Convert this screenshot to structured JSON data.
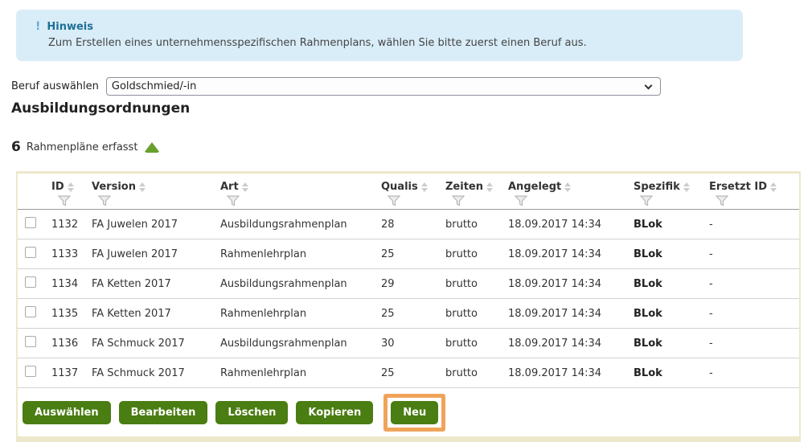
{
  "notice": {
    "icon": "!",
    "title": "Hinweis",
    "text": "Zum Erstellen eines unternehmensspezifischen Rahmenplans, wählen Sie bitte zuerst einen Beruf aus."
  },
  "beruf": {
    "label": "Beruf auswählen",
    "selected": "Goldschmied/-in"
  },
  "page": {
    "title": "Ausbildungsordnungen"
  },
  "summary": {
    "count": "6",
    "label": "Rahmenpläne erfasst",
    "toggle_icon": "triangle-up"
  },
  "table": {
    "columns": [
      {
        "label": "ID"
      },
      {
        "label": "Version"
      },
      {
        "label": "Art"
      },
      {
        "label": "Qualis"
      },
      {
        "label": "Zeiten"
      },
      {
        "label": "Angelegt"
      },
      {
        "label": "Spezifik"
      },
      {
        "label": "Ersetzt ID"
      }
    ],
    "rows": [
      {
        "id": "1132",
        "version": "FA Juwelen 2017",
        "art": "Ausbildungsrahmenplan",
        "qualis": "28",
        "zeiten": "brutto",
        "angelegt": "18.09.2017 14:34",
        "spezifik": "BLok",
        "ersetzt": "-"
      },
      {
        "id": "1133",
        "version": "FA Juwelen 2017",
        "art": "Rahmenlehrplan",
        "qualis": "25",
        "zeiten": "brutto",
        "angelegt": "18.09.2017 14:34",
        "spezifik": "BLok",
        "ersetzt": "-"
      },
      {
        "id": "1134",
        "version": "FA Ketten 2017",
        "art": "Ausbildungsrahmenplan",
        "qualis": "29",
        "zeiten": "brutto",
        "angelegt": "18.09.2017 14:34",
        "spezifik": "BLok",
        "ersetzt": "-"
      },
      {
        "id": "1135",
        "version": "FA Ketten 2017",
        "art": "Rahmenlehrplan",
        "qualis": "25",
        "zeiten": "brutto",
        "angelegt": "18.09.2017 14:34",
        "spezifik": "BLok",
        "ersetzt": "-"
      },
      {
        "id": "1136",
        "version": "FA Schmuck 2017",
        "art": "Ausbildungsrahmenplan",
        "qualis": "30",
        "zeiten": "brutto",
        "angelegt": "18.09.2017 14:34",
        "spezifik": "BLok",
        "ersetzt": "-"
      },
      {
        "id": "1137",
        "version": "FA Schmuck 2017",
        "art": "Rahmenlehrplan",
        "qualis": "25",
        "zeiten": "brutto",
        "angelegt": "18.09.2017 14:34",
        "spezifik": "BLok",
        "ersetzt": "-"
      }
    ]
  },
  "actions": {
    "auswaehlen": "Auswählen",
    "bearbeiten": "Bearbeiten",
    "loeschen": "Löschen",
    "kopieren": "Kopieren",
    "neu": "Neu",
    "highlighted_button": "Neu"
  },
  "colors": {
    "notice_bg": "#d9edf8",
    "notice_title": "#1d6e96",
    "button_green": "#4a7d12",
    "toggle_green": "#69a02c",
    "highlight_orange": "#f0a45a",
    "table_border": "#ede8cb"
  }
}
